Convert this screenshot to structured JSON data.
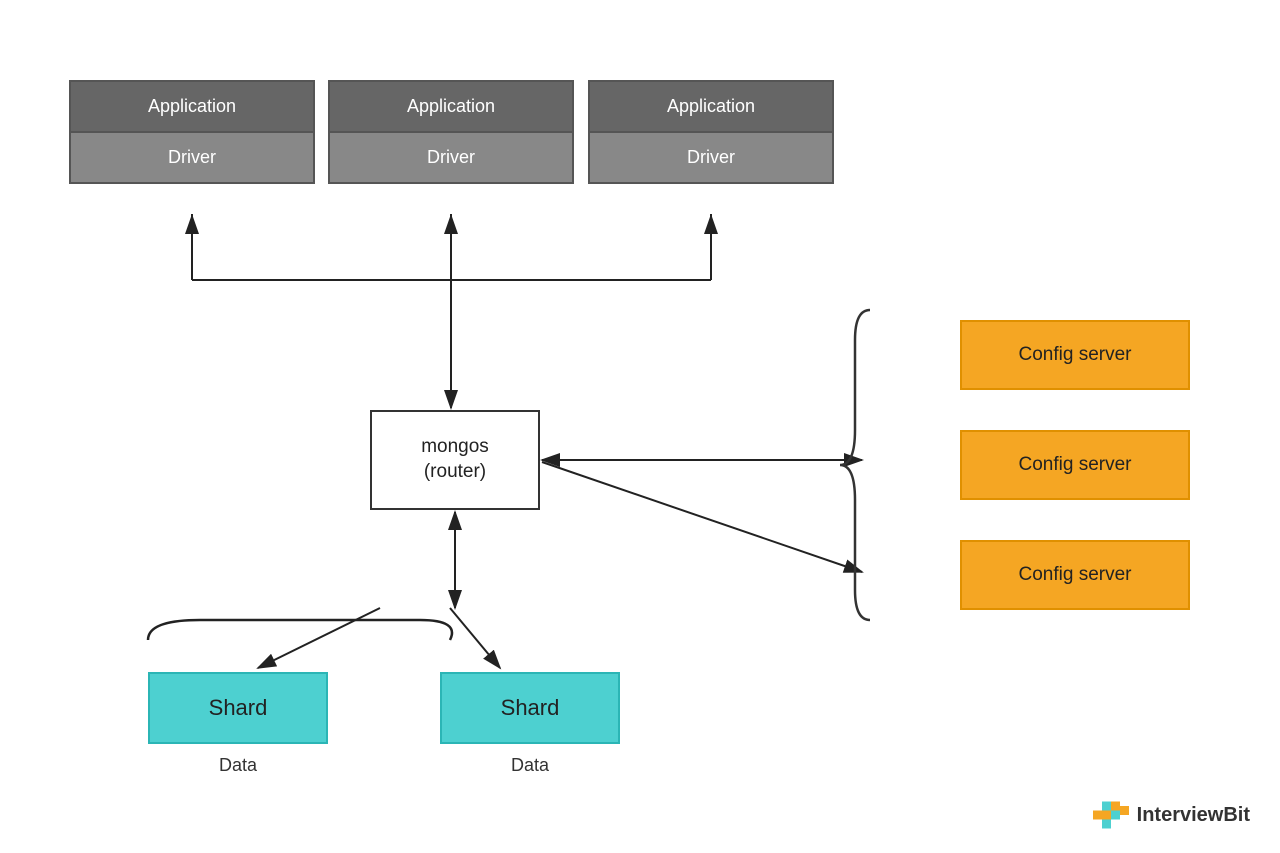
{
  "boxes": {
    "app1": {
      "label_top": "Application",
      "label_bottom": "Driver"
    },
    "app2": {
      "label_top": "Application",
      "label_bottom": "Driver"
    },
    "app3": {
      "label_top": "Application",
      "label_bottom": "Driver"
    },
    "mongos": {
      "label": "mongos\n(router)"
    },
    "config1": {
      "label": "Config server"
    },
    "config2": {
      "label": "Config server"
    },
    "config3": {
      "label": "Config server"
    },
    "shard1": {
      "label": "Shard"
    },
    "shard2": {
      "label": "Shard"
    }
  },
  "labels": {
    "data1": "Data",
    "data2": "Data"
  },
  "logo": {
    "text": "InterviewBit"
  }
}
